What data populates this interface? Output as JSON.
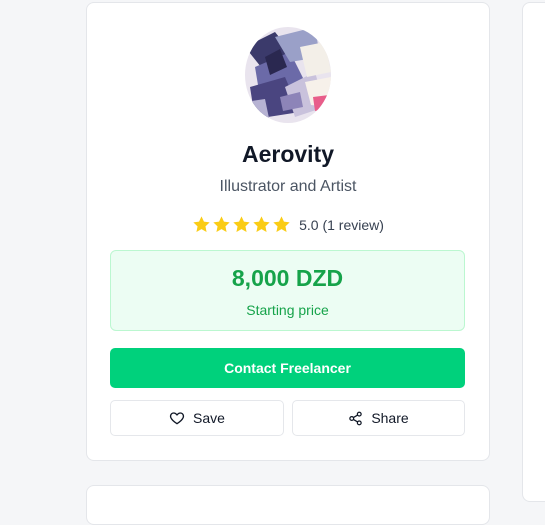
{
  "profile": {
    "name": "Aerovity",
    "tagline": "Illustrator and Artist",
    "avatar_icon": "abstract-artwork-avatar",
    "rating": {
      "stars": 5,
      "max_stars": 5,
      "text": "5.0 (1 review)",
      "star_color": "#facc15"
    },
    "price": {
      "amount": "8,000 DZD",
      "label": "Starting price",
      "color": "#16a34a",
      "background": "#ecfdf3"
    },
    "actions": {
      "contact_label": "Contact Freelancer",
      "contact_color": "#00d17c",
      "save_label": "Save",
      "save_icon": "heart-icon",
      "share_label": "Share",
      "share_icon": "share-icon"
    }
  }
}
